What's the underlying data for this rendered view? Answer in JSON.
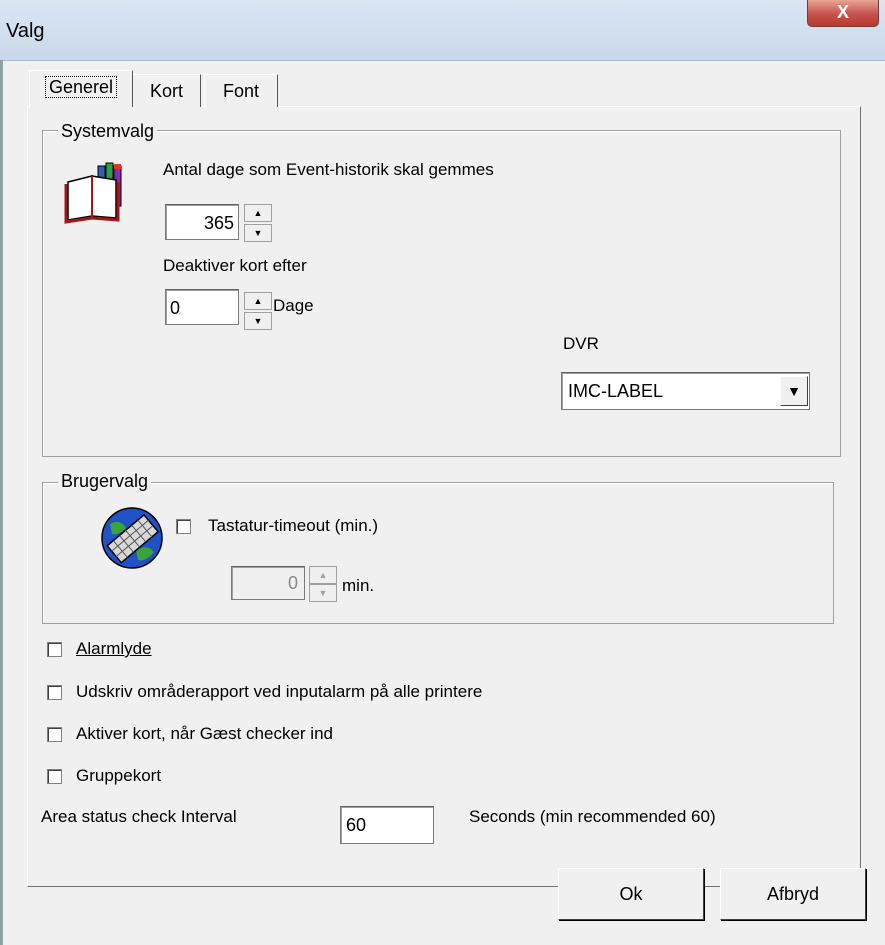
{
  "window": {
    "title": "Valg",
    "close_glyph": "X"
  },
  "tabs": [
    {
      "label": "Generel"
    },
    {
      "label": "Kort"
    },
    {
      "label": "Font"
    }
  ],
  "system": {
    "legend": "Systemvalg",
    "icon": "book-icon",
    "history_label": "Antal dage som Event-historik skal gemmes",
    "history_value": "365",
    "deactivate_label": "Deaktiver kort efter",
    "deactivate_value": "0",
    "deactivate_unit": "Dage",
    "dvr_label": "DVR",
    "dvr_selected": "IMC-LABEL"
  },
  "bruger": {
    "legend": "Brugervalg",
    "icon": "keyboard-globe-icon",
    "timeout_label": "Tastatur-timeout (min.)",
    "timeout_value": "0",
    "timeout_unit": "min."
  },
  "options": {
    "alarmlyde": "Alarmlyde",
    "udskriv": "Udskriv områderapport ved inputalarm på alle printere",
    "aktiver": "Aktiver kort, når Gæst checker ind",
    "gruppekort": "Gruppekort"
  },
  "area_status": {
    "label": "Area status check Interval",
    "value": "60",
    "hint": "Seconds (min recommended 60)"
  },
  "buttons": {
    "ok": "Ok",
    "cancel": "Afbryd"
  }
}
